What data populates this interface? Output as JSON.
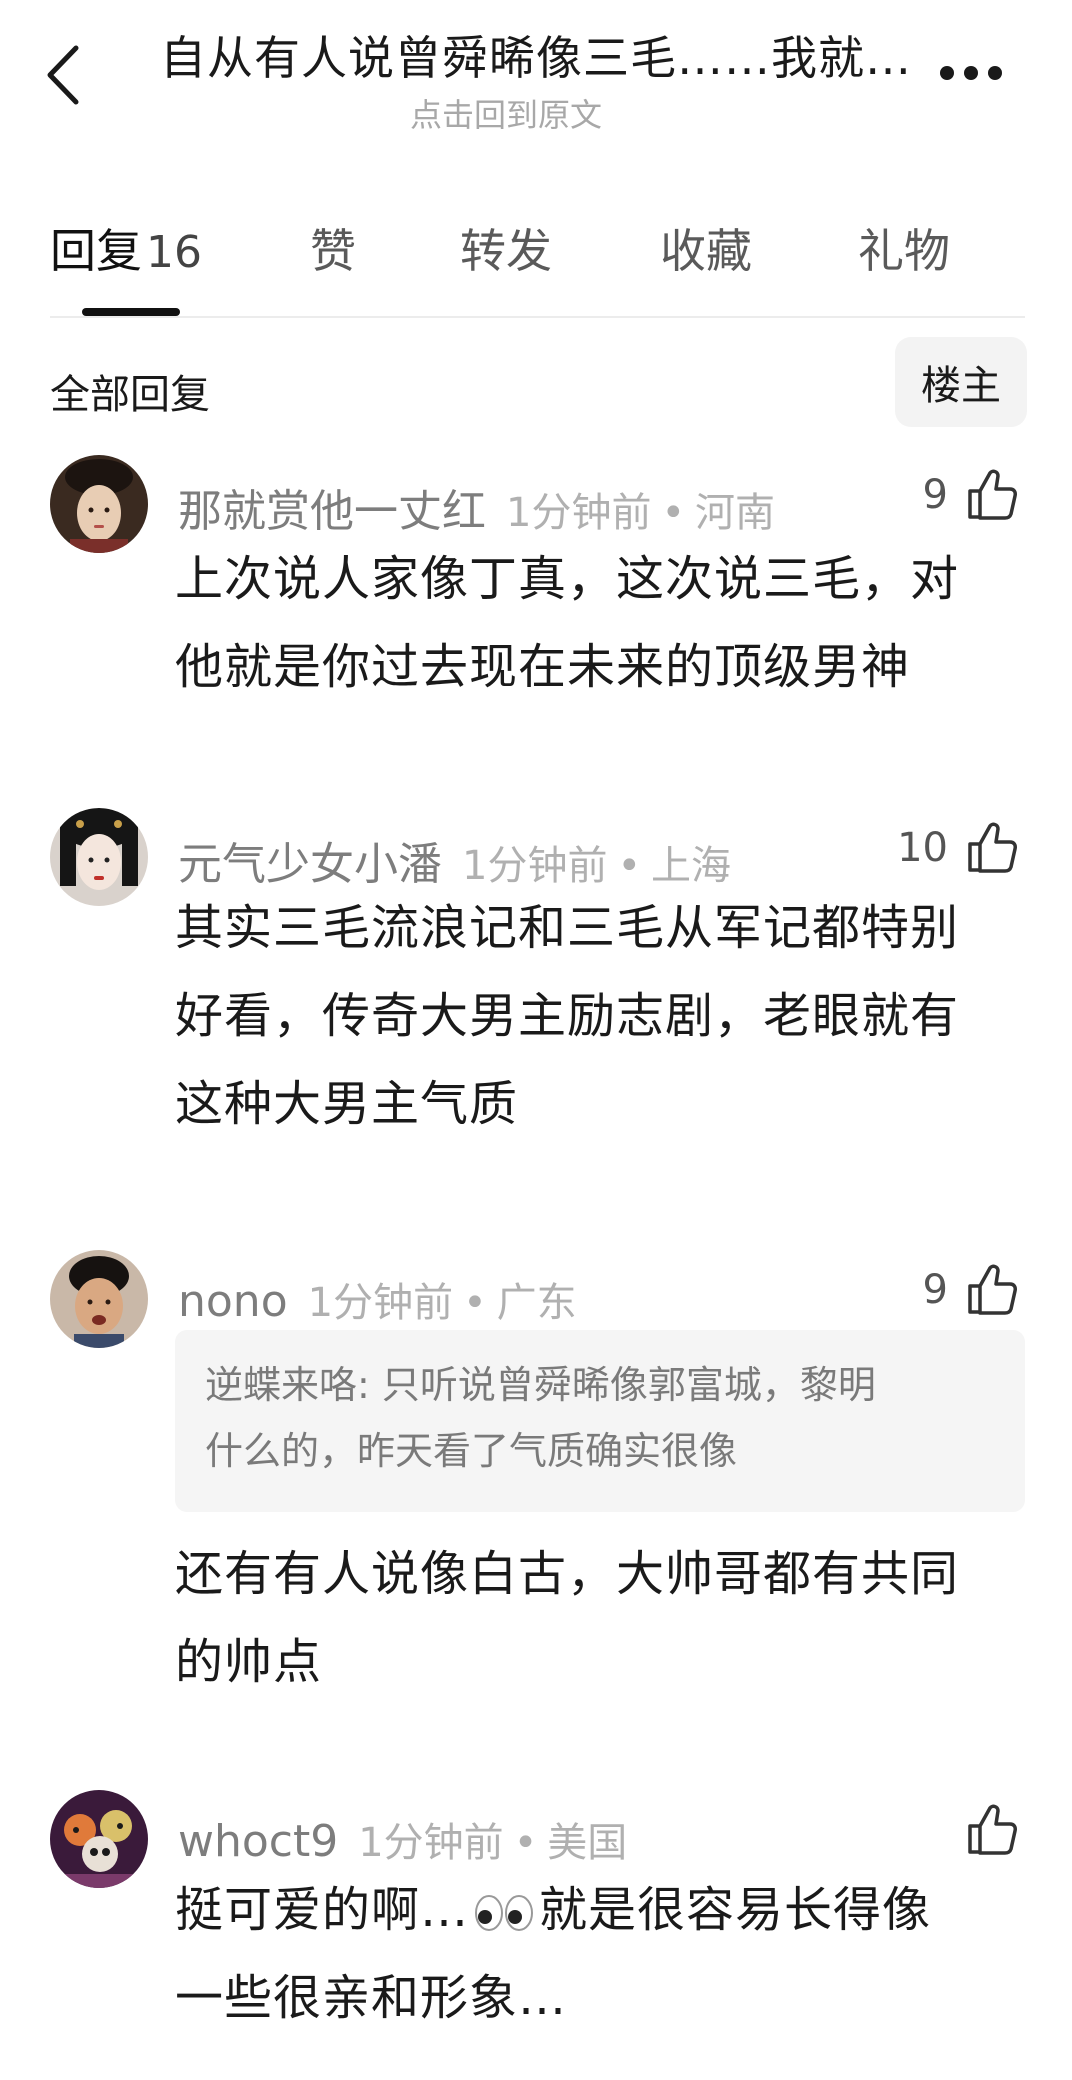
{
  "header": {
    "title": "自从有人说曾舜晞像三毛……我就…",
    "subtitle": "点击回到原文"
  },
  "tabs": [
    {
      "label": "回复",
      "count": "16"
    },
    {
      "label": "赞"
    },
    {
      "label": "转发"
    },
    {
      "label": "收藏"
    },
    {
      "label": "礼物"
    }
  ],
  "filter": {
    "label": "全部回复",
    "op_button": "楼主"
  },
  "comments": [
    {
      "username": "那就赏他一丈红",
      "time": "1分钟前",
      "location": "河南",
      "likes": "9",
      "lines": [
        "上次说人家像丁真，这次说三毛，对",
        "他就是你过去现在未来的顶级男神"
      ]
    },
    {
      "username": "元气少女小潘",
      "time": "1分钟前",
      "location": "上海",
      "likes": "10",
      "lines": [
        "其实三毛流浪记和三毛从军记都特别",
        "好看，传奇大男主励志剧，老眼就有",
        "这种大男主气质"
      ]
    },
    {
      "username": "nono",
      "time": "1分钟前",
      "location": "广东",
      "likes": "9",
      "quote": {
        "author": "逆蝶来咯",
        "lines": [
          "只听说曾舜晞像郭富城，黎明",
          "什么的，昨天看了气质确实很像"
        ]
      },
      "lines": [
        "还有有人说像白古，大帅哥都有共同",
        "的帅点"
      ]
    },
    {
      "username": "whoct9",
      "time": "1分钟前",
      "location": "美国",
      "likes": "",
      "line1_before": "挺可爱的啊…",
      "line1_after": "就是很容易长得像",
      "line2": "一些很亲和形象…"
    }
  ],
  "colors": {
    "text_primary": "#1a1a1a",
    "text_meta": "#b0b0b0",
    "quote_bg": "#f5f5f5",
    "op_button_bg": "#f3f3f3"
  }
}
